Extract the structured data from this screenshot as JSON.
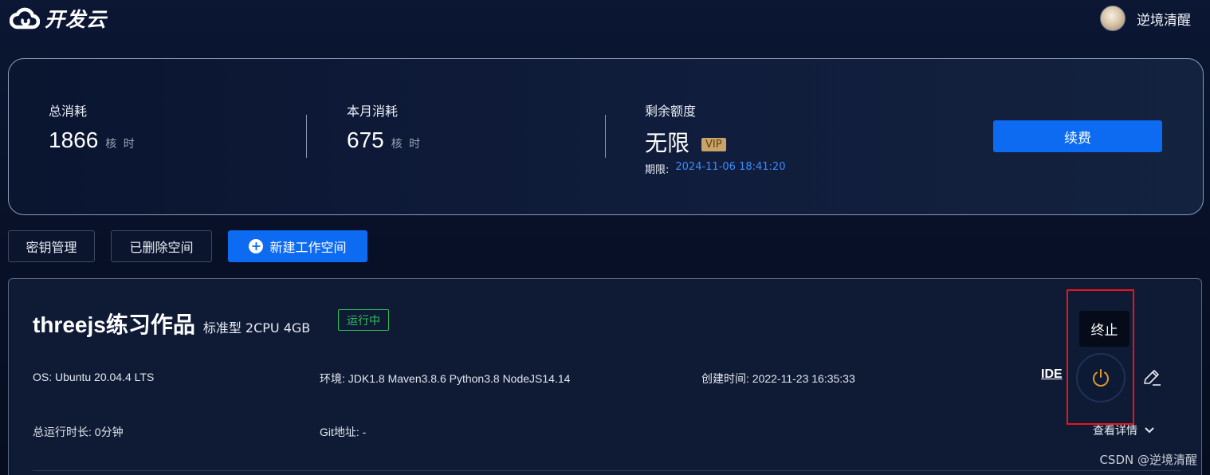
{
  "header": {
    "logo_text": "开发云",
    "username": "逆境清醒"
  },
  "summary": {
    "total": {
      "label": "总消耗",
      "value": "1866",
      "unit": "核 时"
    },
    "month": {
      "label": "本月消耗",
      "value": "675",
      "unit": "核 时"
    },
    "remaining": {
      "label": "剩余额度",
      "value": "无限",
      "badge": "VIP",
      "expire_label": "期限:",
      "expire_date": "2024-11-06 18:41:20"
    },
    "renew_label": "续费"
  },
  "actions": {
    "key_manage": "密钥管理",
    "deleted_spaces": "已删除空间",
    "new_workspace": "新建工作空间"
  },
  "workspace": {
    "name": "threejs练习作品",
    "spec": "标准型 2CPU 4GB",
    "status": "运行中",
    "os": "OS: Ubuntu 20.04.4 LTS",
    "env": "环境: JDK1.8 Maven3.8.6 Python3.8 NodeJS14.14",
    "created": "创建时间: 2022-11-23 16:35:33",
    "runtime": "总运行时长: 0分钟",
    "git": "Git地址: -",
    "ide_label": "IDE",
    "tooltip": "终止",
    "details_label": "查看详情"
  },
  "watermark": "CSDN @逆境清醒",
  "colors": {
    "accent": "#0d6bf2",
    "status_green": "#2ebf5e",
    "power_orange": "#e0962b",
    "highlight_red": "#e8141a",
    "vip_gold": "#c9a468",
    "link_blue": "#3d8bff"
  },
  "icons": [
    "cloud-logo-icon",
    "plus-circle-icon",
    "power-icon",
    "edit-icon",
    "chevron-down-icon"
  ]
}
